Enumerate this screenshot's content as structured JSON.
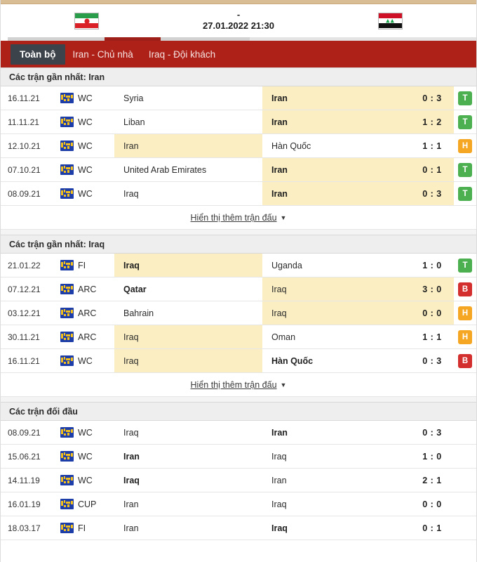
{
  "header": {
    "home_team": "Iran",
    "away_team": "Iraq",
    "home_flag": "iran-flag",
    "away_flag": "iraq-flag",
    "score_placeholder": "-",
    "kickoff": "27.01.2022 21:30"
  },
  "tabs": [
    {
      "label": "Toàn bộ",
      "active": true
    },
    {
      "label": "Iran - Chủ nhà",
      "active": false
    },
    {
      "label": "Iraq - Đội khách",
      "active": false
    }
  ],
  "colors": {
    "tabbar_red": "#ad2119",
    "tab_active_gray": "#3d434a",
    "highlight_cream": "#faeec2",
    "win_green": "#4caf50",
    "draw_orange": "#f5a623",
    "loss_red": "#d32f2f",
    "top_strip_tan": "#d9bd95",
    "section_header_gray": "#eeeeee"
  },
  "sections": [
    {
      "title": "Các trận gần nhất: Iran",
      "show_more": "Hiển thị thêm trận đấu",
      "has_show_more": true,
      "rows": [
        {
          "date": "16.11.21",
          "icon": "world-icon",
          "comp": "WC",
          "home": "Syria",
          "away": "Iran",
          "score": "0 : 3",
          "badge": "T",
          "home_hl": false,
          "away_hl": true,
          "home_win": false,
          "away_win": true
        },
        {
          "date": "11.11.21",
          "icon": "world-icon",
          "comp": "WC",
          "home": "Liban",
          "away": "Iran",
          "score": "1 : 2",
          "badge": "T",
          "home_hl": false,
          "away_hl": true,
          "home_win": false,
          "away_win": true
        },
        {
          "date": "12.10.21",
          "icon": "world-icon",
          "comp": "WC",
          "home": "Iran",
          "away": "Hàn Quốc",
          "score": "1 : 1",
          "badge": "H",
          "home_hl": true,
          "away_hl": false,
          "home_win": false,
          "away_win": false
        },
        {
          "date": "07.10.21",
          "icon": "world-icon",
          "comp": "WC",
          "home": "United Arab Emirates",
          "away": "Iran",
          "score": "0 : 1",
          "badge": "T",
          "home_hl": false,
          "away_hl": true,
          "home_win": false,
          "away_win": true
        },
        {
          "date": "08.09.21",
          "icon": "world-icon",
          "comp": "WC",
          "home": "Iraq",
          "away": "Iran",
          "score": "0 : 3",
          "badge": "T",
          "home_hl": false,
          "away_hl": true,
          "home_win": false,
          "away_win": true
        }
      ]
    },
    {
      "title": "Các trận gần nhất: Iraq",
      "show_more": "Hiển thị thêm trận đấu",
      "has_show_more": true,
      "rows": [
        {
          "date": "21.01.22",
          "icon": "world-icon",
          "comp": "FI",
          "home": "Iraq",
          "away": "Uganda",
          "score": "1 : 0",
          "badge": "T",
          "home_hl": true,
          "away_hl": false,
          "home_win": true,
          "away_win": false
        },
        {
          "date": "07.12.21",
          "icon": "world-icon",
          "comp": "ARC",
          "home": "Qatar",
          "away": "Iraq",
          "score": "3 : 0",
          "badge": "B",
          "home_hl": false,
          "away_hl": true,
          "home_win": true,
          "away_win": false
        },
        {
          "date": "03.12.21",
          "icon": "world-icon",
          "comp": "ARC",
          "home": "Bahrain",
          "away": "Iraq",
          "score": "0 : 0",
          "badge": "H",
          "home_hl": false,
          "away_hl": true,
          "home_win": false,
          "away_win": false
        },
        {
          "date": "30.11.21",
          "icon": "world-icon",
          "comp": "ARC",
          "home": "Iraq",
          "away": "Oman",
          "score": "1 : 1",
          "badge": "H",
          "home_hl": true,
          "away_hl": false,
          "home_win": false,
          "away_win": false
        },
        {
          "date": "16.11.21",
          "icon": "world-icon",
          "comp": "WC",
          "home": "Iraq",
          "away": "Hàn Quốc",
          "score": "0 : 3",
          "badge": "B",
          "home_hl": true,
          "away_hl": false,
          "home_win": false,
          "away_win": true
        }
      ]
    },
    {
      "title": "Các trận đối đầu",
      "show_more": "",
      "has_show_more": false,
      "rows": [
        {
          "date": "08.09.21",
          "icon": "world-icon",
          "comp": "WC",
          "home": "Iraq",
          "away": "Iran",
          "score": "0 : 3",
          "badge": "",
          "home_hl": false,
          "away_hl": false,
          "home_win": false,
          "away_win": true
        },
        {
          "date": "15.06.21",
          "icon": "world-icon",
          "comp": "WC",
          "home": "Iran",
          "away": "Iraq",
          "score": "1 : 0",
          "badge": "",
          "home_hl": false,
          "away_hl": false,
          "home_win": true,
          "away_win": false
        },
        {
          "date": "14.11.19",
          "icon": "world-icon",
          "comp": "WC",
          "home": "Iraq",
          "away": "Iran",
          "score": "2 : 1",
          "badge": "",
          "home_hl": false,
          "away_hl": false,
          "home_win": true,
          "away_win": false
        },
        {
          "date": "16.01.19",
          "icon": "world-icon",
          "comp": "CUP",
          "home": "Iran",
          "away": "Iraq",
          "score": "0 : 0",
          "badge": "",
          "home_hl": false,
          "away_hl": false,
          "home_win": false,
          "away_win": false
        },
        {
          "date": "18.03.17",
          "icon": "world-icon",
          "comp": "FI",
          "home": "Iran",
          "away": "Iraq",
          "score": "0 : 1",
          "badge": "",
          "home_hl": false,
          "away_hl": false,
          "home_win": false,
          "away_win": true
        }
      ]
    }
  ]
}
